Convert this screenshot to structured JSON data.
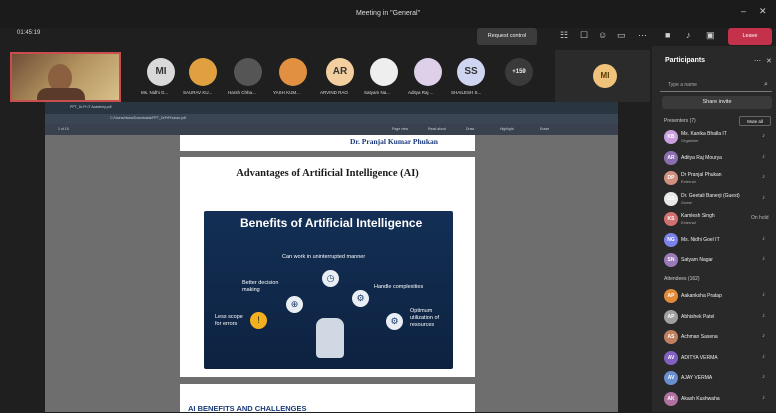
{
  "window": {
    "title": "Meeting in \"General\""
  },
  "toolbar": {
    "timer": "01:45:19",
    "request_control": "Request control",
    "leave": "Leave"
  },
  "strip": {
    "people": [
      {
        "initials": "MI",
        "name": "Ms. Nidhi G...",
        "color": "#d9d9d9"
      },
      {
        "initials": "",
        "name": "SAURAV KU...",
        "color": "#e0a040"
      },
      {
        "initials": "",
        "name": "Harsh Chha...",
        "color": "#555555"
      },
      {
        "initials": "",
        "name": "YASH KUM...",
        "color": "#e09040"
      },
      {
        "initials": "AR",
        "name": "ARVIND RAO",
        "color": "#f3cfa0"
      },
      {
        "initials": "",
        "name": "Satyam Na...",
        "color": "#eeeeee"
      },
      {
        "initials": "",
        "name": "Aditya Raj ...",
        "color": "#ddd0e8"
      },
      {
        "initials": "SS",
        "name": "SHAILESH S...",
        "color": "#cfd5f0"
      },
      {
        "initials": "+159",
        "name": "",
        "color": "#3a3a3a"
      }
    ],
    "big_initials": "MI"
  },
  "browser": {
    "tab": "PPT_Dr.Pr.IT Academy.pdf",
    "address": "C:/Users/nisha/Downloads/PPT_DrPrPhukan.pdf",
    "page": "1 of 15",
    "read_aloud": "Read aloud",
    "draw": "Draw",
    "highlight": "Highlight",
    "erase": "Erase",
    "page_view": "Page view"
  },
  "pdf": {
    "author": "Dr. Pranjal Kumar Phukan",
    "heading": "Advantages of Artificial Intelligence (AI)",
    "slide_title": "Benefits of Artificial Intelligence",
    "b1": "Can work in uninterrupted manner",
    "b2": "Better decision making",
    "b3": "Handle complexities",
    "b4": "Less scope for errors",
    "b5": "Optimum utilization of resources",
    "next": "AI BENEFITS AND CHALLENGES"
  },
  "sidebar": {
    "title": "Participants",
    "search_placeholder": "Type a name",
    "share_invite": "Share invite",
    "presenters_label": "Presenters (7)",
    "mute_all": "Mute all",
    "presenters": [
      {
        "name": "Ms. Kanika Bhalla IT",
        "sub": "Organizer",
        "color": "#c9a0dc",
        "ini": "KB"
      },
      {
        "name": "Aditya Raj Mourya",
        "sub": "",
        "color": "#8a6fb0",
        "ini": "AR"
      },
      {
        "name": "Dr Pranjal Phukan",
        "sub": "External",
        "color": "#d09080",
        "ini": "DP"
      },
      {
        "name": "Dr. Geetali Banerji (Guest)",
        "sub": "Guest",
        "color": "#e8e8e8",
        "ini": "GB"
      },
      {
        "name": "Kamlesh Singh",
        "sub": "External",
        "color": "#d07070",
        "ini": "KS"
      },
      {
        "name": "Ms. Nidhi Goel IT",
        "sub": "",
        "color": "#7b83eb",
        "ini": "NG"
      },
      {
        "name": "Satyam Nagar",
        "sub": "",
        "color": "#9a7ab8",
        "ini": "SN"
      }
    ],
    "on_hold": "On hold",
    "attendees_label": "Attendees (162)",
    "attendees": [
      {
        "name": "Aakanksha Pratap",
        "color": "#e08a3a",
        "ini": "AP"
      },
      {
        "name": "Abhishek Patel",
        "color": "#a0a0a0",
        "ini": "AP"
      },
      {
        "name": "Achman Saxena",
        "color": "#c08060",
        "ini": "AS"
      },
      {
        "name": "ADITYA VERMA",
        "color": "#8060c0",
        "ini": "AV"
      },
      {
        "name": "AJAY VERMA",
        "color": "#6a8fd0",
        "ini": "AV"
      },
      {
        "name": "Akash Kushwaha",
        "color": "#b070a0",
        "ini": "AK"
      }
    ]
  }
}
